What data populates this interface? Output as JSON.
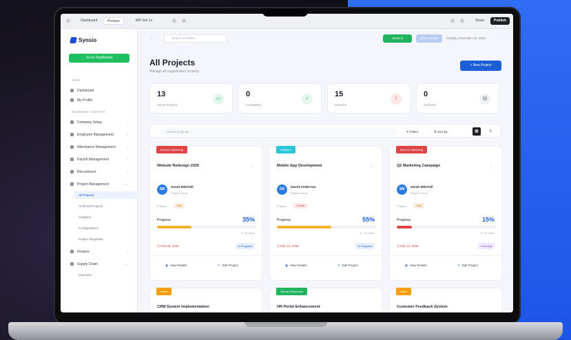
{
  "browser": {
    "tabs": [
      "Dashboard",
      "Preview",
      "WP Get 1s"
    ],
    "right": [
      "Share",
      "Publish"
    ]
  },
  "sidebar": {
    "brand": "Synsio",
    "dashboard_button": "Go to Dashboard",
    "section_main": "MAIN",
    "main_items": [
      "Dashboard",
      "My Profile"
    ],
    "section_business": "BUSINESS CONTENT",
    "items": [
      "Company Setup",
      "Employee Management",
      "Attendance Management",
      "Payroll Management",
      "Recruitment",
      "Project Management"
    ],
    "project_sub": [
      "All Projects",
      "Archived Projects",
      "Analytics",
      "Configurations",
      "Project Templates"
    ],
    "items_after": [
      "Finance",
      "Supply Chain"
    ],
    "supply_sub": [
      "Overview"
    ]
  },
  "header": {
    "search_placeholder": "Search in HRMS...",
    "green_btn": "Clock In",
    "blue_btn": "Quick Actions",
    "date": "Sunday, November 23, 2025"
  },
  "page": {
    "title": "All Projects",
    "subtitle": "Manage all organization projects",
    "new_button": "New Project"
  },
  "stats": [
    {
      "value": "13",
      "label": "Active Projects",
      "color": "#22b35e",
      "bg": "#e3f7ec",
      "icon": "folder-icon"
    },
    {
      "value": "0",
      "label": "Completed",
      "color": "#22b35e",
      "bg": "#e3f7ec",
      "icon": "check-circle-icon"
    },
    {
      "value": "15",
      "label": "Overdue",
      "color": "#e03e3e",
      "bg": "#fde8e8",
      "icon": "alert-icon"
    },
    {
      "value": "0",
      "label": "Archived",
      "color": "#6b7280",
      "bg": "#f0f1f4",
      "icon": "archive-icon"
    }
  ],
  "filters": {
    "search_placeholder": "Search projects...",
    "filters_label": "Filters",
    "sort_label": "Sort By"
  },
  "cards": [
    {
      "tag": "Brand & Marketing",
      "tag_color": "#e04545",
      "title": "Website Redesign 2025",
      "owner_initials": "SM",
      "owner": "Sarah Mitchell",
      "role": "Project Owner",
      "tasks": "5 Tasks",
      "priority": "High",
      "prio_bg": "#fdeee0",
      "prio_color": "#d9822b",
      "progress_label": "Progress",
      "progress": 35,
      "bar_color": "#f0b429",
      "tasks_done": "8 / 23 Tasks",
      "due": "Feb 28, 2025",
      "status": "In Progress",
      "status_bg": "#e6efff",
      "status_color": "#1b5fd6",
      "view": "View Details",
      "edit": "Edit Project"
    },
    {
      "tag": "Software",
      "tag_color": "#2cc4d8",
      "title": "Mobile App Development",
      "owner_initials": "DA",
      "owner": "David Anderson",
      "role": "Project Owner",
      "tasks": "8 Tasks",
      "priority": "Critical",
      "prio_bg": "#fde8e8",
      "prio_color": "#e03e3e",
      "progress_label": "Progress",
      "progress": 55,
      "bar_color": "#f0b429",
      "tasks_done": "11 / 20 Tasks",
      "due": "Mar 31, 2025",
      "status": "In Progress",
      "status_bg": "#e6efff",
      "status_color": "#1b5fd6",
      "view": "View Details",
      "edit": "Edit Project"
    },
    {
      "tag": "Brand & Marketing",
      "tag_color": "#e04545",
      "title": "Q2 Marketing Campaign",
      "owner_initials": "SM",
      "owner": "Sarah Mitchell",
      "role": "Project Owner",
      "tasks": "4 Tasks",
      "priority": "High",
      "prio_bg": "#fdeee0",
      "prio_color": "#d9822b",
      "progress_label": "Progress",
      "progress": 15,
      "bar_color": "#e04545",
      "tasks_done": "3 / 20 Tasks",
      "due": "Mar 31, 2025",
      "status": "Planning",
      "status_bg": "#f1e8ff",
      "status_color": "#7c4ddb",
      "view": "View Details",
      "edit": "Edit Project"
    }
  ],
  "cards_row2": [
    {
      "tag": "Sales",
      "tag_color": "#f59e0b",
      "title": "CRM System Implementation"
    },
    {
      "tag": "Human Resources",
      "tag_color": "#22b35e",
      "title": "HR Portal Enhancement"
    },
    {
      "tag": "Sales",
      "tag_color": "#f59e0b",
      "title": "Customer Feedback System"
    }
  ]
}
